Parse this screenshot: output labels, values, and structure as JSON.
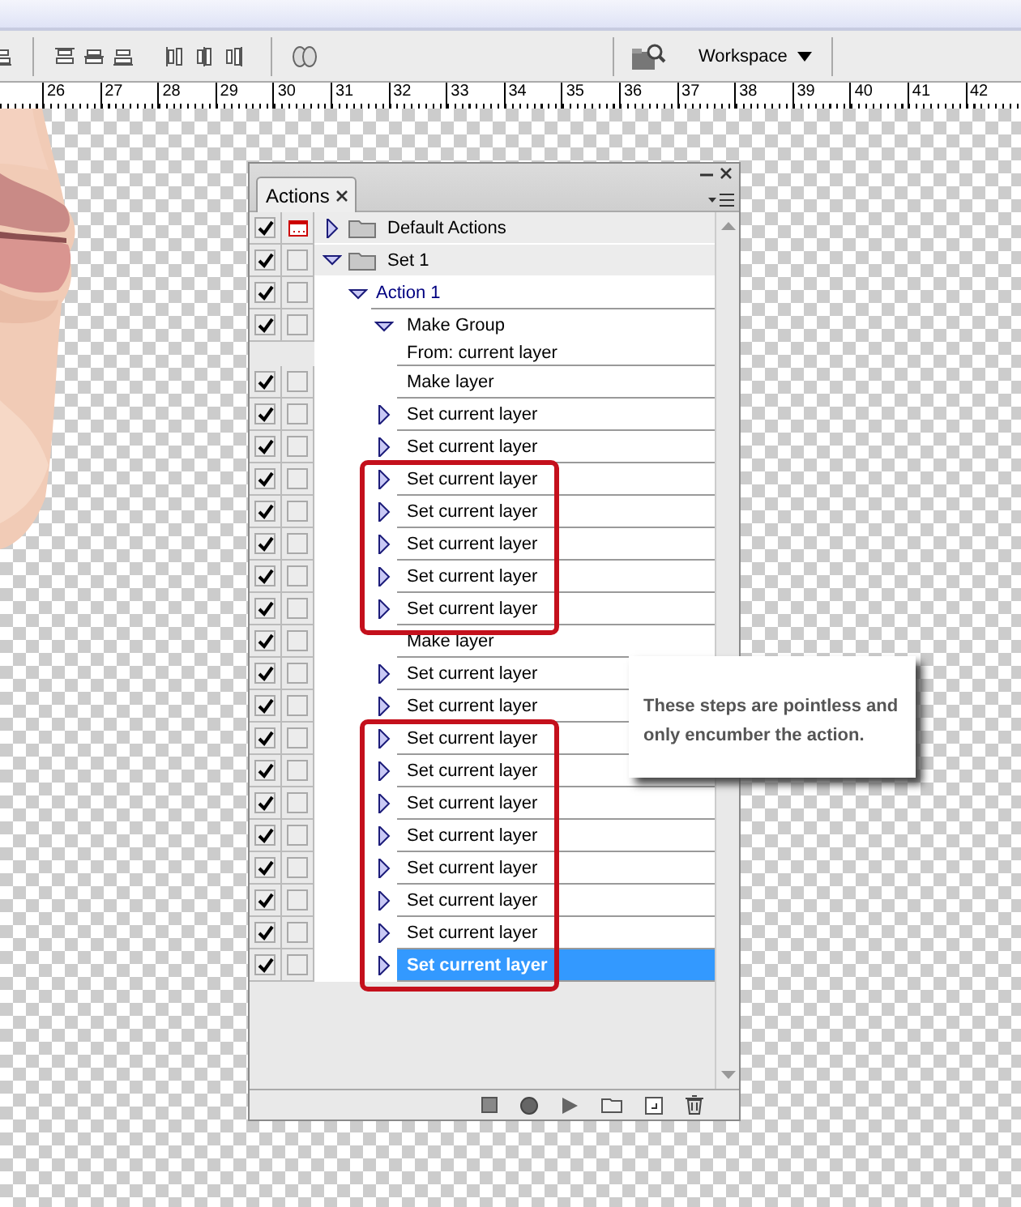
{
  "toolbar": {
    "workspace": "Workspace"
  },
  "ruler": {
    "numbers": [
      "26",
      "27",
      "28",
      "29",
      "30",
      "31",
      "32",
      "33",
      "34",
      "35",
      "36",
      "37",
      "38",
      "39",
      "40",
      "41",
      "42"
    ]
  },
  "panel": {
    "tab": "Actions",
    "actions": [
      {
        "kind": "set",
        "name": "Default Actions",
        "checked": true,
        "dialog": true,
        "expanded": false,
        "selected": false
      },
      {
        "kind": "set",
        "name": "Set 1",
        "checked": true,
        "dialog": false,
        "expanded": true,
        "selected": false,
        "children": [
          {
            "kind": "action",
            "name": "Action 1",
            "checked": true,
            "dialog": false,
            "expanded": true,
            "selected": false,
            "children": [
              {
                "kind": "command",
                "name": "Make Group",
                "checked": true,
                "dialog": false,
                "expanded": true,
                "selected": false,
                "children": [
                  {
                    "kind": "detail",
                    "name": "From: current layer",
                    "selected": false
                  }
                ]
              },
              {
                "kind": "command",
                "name": "Make layer",
                "checked": true,
                "dialog": false,
                "selected": false
              },
              {
                "kind": "command",
                "name": "Set current layer",
                "checked": true,
                "dialog": false,
                "expanded": false,
                "selected": false
              },
              {
                "kind": "command",
                "name": "Set current layer",
                "checked": true,
                "dialog": false,
                "expanded": false,
                "selected": false
              },
              {
                "kind": "highlight",
                "children": [
                  {
                    "kind": "command",
                    "name": "Set current layer",
                    "checked": true,
                    "dialog": false,
                    "expanded": false,
                    "selected": false
                  },
                  {
                    "kind": "command",
                    "name": "Set current layer",
                    "checked": true,
                    "dialog": false,
                    "expanded": false,
                    "selected": false
                  },
                  {
                    "kind": "command",
                    "name": "Set current layer",
                    "checked": true,
                    "dialog": false,
                    "expanded": false,
                    "selected": false
                  },
                  {
                    "kind": "command",
                    "name": "Set current layer",
                    "checked": true,
                    "dialog": false,
                    "expanded": false,
                    "selected": false
                  },
                  {
                    "kind": "command",
                    "name": "Set current layer",
                    "checked": true,
                    "dialog": false,
                    "expanded": false,
                    "selected": false
                  }
                ]
              },
              {
                "kind": "command",
                "name": "Make layer",
                "checked": true,
                "dialog": false,
                "selected": false
              },
              {
                "kind": "command",
                "name": "Set current layer",
                "checked": true,
                "dialog": false,
                "expanded": false,
                "selected": false
              },
              {
                "kind": "command",
                "name": "Set current layer",
                "checked": true,
                "dialog": false,
                "expanded": false,
                "selected": false
              },
              {
                "kind": "highlight",
                "children": [
                  {
                    "kind": "command",
                    "name": "Set current layer",
                    "checked": true,
                    "dialog": false,
                    "expanded": false,
                    "selected": false
                  },
                  {
                    "kind": "command",
                    "name": "Set current layer",
                    "checked": true,
                    "dialog": false,
                    "expanded": false,
                    "selected": false
                  },
                  {
                    "kind": "command",
                    "name": "Set current layer",
                    "checked": true,
                    "dialog": false,
                    "expanded": false,
                    "selected": false
                  },
                  {
                    "kind": "command",
                    "name": "Set current layer",
                    "checked": true,
                    "dialog": false,
                    "expanded": false,
                    "selected": false
                  },
                  {
                    "kind": "command",
                    "name": "Set current layer",
                    "checked": true,
                    "dialog": false,
                    "expanded": false,
                    "selected": false
                  },
                  {
                    "kind": "command",
                    "name": "Set current layer",
                    "checked": true,
                    "dialog": false,
                    "expanded": false,
                    "selected": false
                  },
                  {
                    "kind": "command",
                    "name": "Set current layer",
                    "checked": true,
                    "dialog": false,
                    "expanded": false,
                    "selected": false
                  },
                  {
                    "kind": "command",
                    "name": "Set current layer",
                    "checked": true,
                    "dialog": false,
                    "expanded": false,
                    "selected": true
                  }
                ]
              }
            ]
          }
        ]
      }
    ]
  },
  "callout": {
    "text": "These steps are pointless and only encumber the action."
  }
}
